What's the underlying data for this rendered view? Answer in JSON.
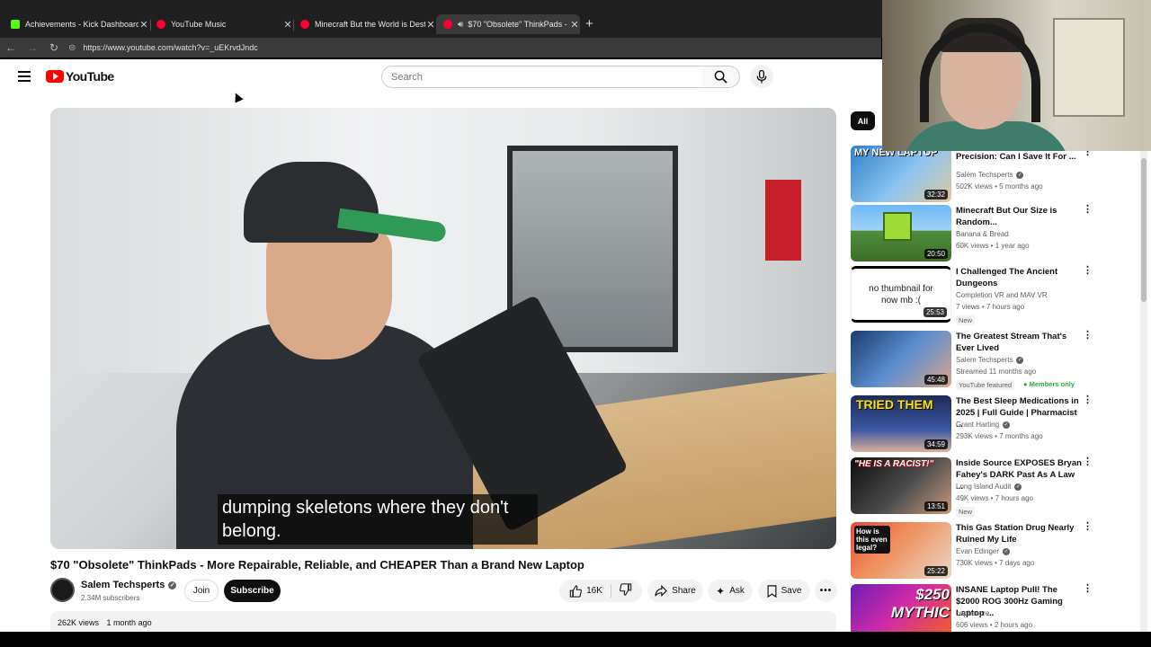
{
  "browser": {
    "tabs": [
      {
        "title": "Achievements - Kick Dashboard",
        "color": "#53fc18"
      },
      {
        "title": "YouTube Music",
        "color": "#ff0033"
      },
      {
        "title": "Minecraft But the World is Destru",
        "color": "#ff0033"
      },
      {
        "title": "$70 \"Obsolete\" ThinkPads - M",
        "color": "#ff0033"
      }
    ],
    "url": "https://www.youtube.com/watch?v=_uEKrvdJndc"
  },
  "header": {
    "logo": "YouTube",
    "search_placeholder": "Search"
  },
  "video": {
    "caption": "dumping skeletons where they don't belong.",
    "title": "$70 \"Obsolete\" ThinkPads - More Repairable, Reliable, and CHEAPER Than a Brand New Laptop",
    "channel": "Salem Techsperts",
    "subscribers": "2.34M subscribers",
    "join": "Join",
    "subscribe": "Subscribe",
    "likes": "16K",
    "share": "Share",
    "ask": "Ask",
    "save": "Save",
    "views": "262K views",
    "age": "1 month ago"
  },
  "sidebar": {
    "chip": "All",
    "recommendations": [
      {
        "title": "Precision: Can I Save It For ...",
        "channel": "Salem Techsperts",
        "verified": true,
        "meta": "502K views • 5 months ago",
        "duration": "32:32",
        "thumb_text": "MY NEW LAPTOP"
      },
      {
        "title": "Minecraft But Our Size is Random...",
        "channel": "Banana & Bread",
        "verified": false,
        "meta": "60K views • 1 year ago",
        "duration": "20:50"
      },
      {
        "title": "I Challenged The Ancient Dungeons",
        "channel": "Completion VR and MAV VR",
        "verified": false,
        "meta": "7 views • 7 hours ago",
        "duration": "25:53",
        "badge": "New",
        "thumb_text": "no thumbnail for now mb :("
      },
      {
        "title": "The Greatest Stream That's Ever Lived",
        "channel": "Salem Techsperts",
        "verified": true,
        "meta": "Streamed 11 months ago",
        "duration": "45:48",
        "badge": "YouTube featured",
        "badge2": "Members only"
      },
      {
        "title": "The Best Sleep Medications in 2025 | Full Guide | Pharmacist ...",
        "channel": "Grant Harting",
        "verified": true,
        "meta": "293K views • 7 months ago",
        "duration": "34:59",
        "thumb_text": "TRIED THEM"
      },
      {
        "title": "Inside Source EXPOSES Bryan Fahey's DARK Past As A Law ...",
        "channel": "Long Island Audit",
        "verified": true,
        "meta": "49K views • 7 hours ago",
        "duration": "13:51",
        "badge": "New",
        "thumb_text": "\"HE IS A RACIST!\""
      },
      {
        "title": "This Gas Station Drug Nearly Ruined My Life",
        "channel": "Evan Edinger",
        "verified": true,
        "meta": "730K views • 7 days ago",
        "duration": "25:22",
        "thumb_text": "How is this even legal?"
      },
      {
        "title": "INSANE Laptop Pull! The $2000 ROG 300Hz Gaming Laptop ...",
        "channel": "cephacore",
        "verified": false,
        "meta": "606 views • 2 hours ago",
        "duration": "",
        "thumb_text": "$250 MYTHIC"
      }
    ]
  }
}
